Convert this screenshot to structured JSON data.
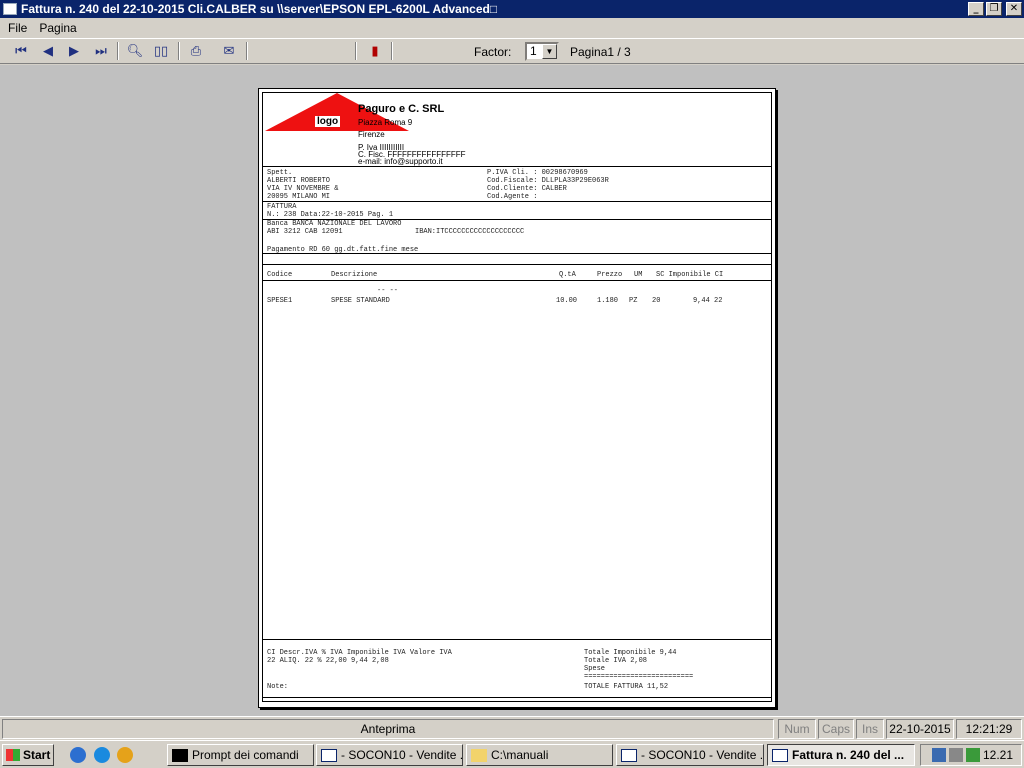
{
  "window": {
    "title": "Fattura n.  240 del 22-10-2015 Cli.CALBER su \\\\server\\EPSON EPL-6200L Advanced□"
  },
  "menu": {
    "file": "File",
    "pagina": "Pagina"
  },
  "toolbar": {
    "factor_label": "Factor:",
    "factor_value": "1",
    "page_indicator": "Pagina1 / 3"
  },
  "invoice": {
    "logo_text": "logo",
    "company": {
      "name": "Paguro e C. SRL",
      "address": "Piazza Roma 9",
      "city": "Firenze",
      "piva": "P. Iva  IIIIIIIIIII",
      "cf": "C. Fisc. FFFFFFFFFFFFFFFF",
      "email": "e-mail: info@supporto.it"
    },
    "customer": {
      "spett": "Spett.",
      "name": "ALBERTI ROBERTO",
      "street": "VIA IV NOVEMBRE &",
      "city": "20095 MILANO MI"
    },
    "customer_codes": {
      "piva": "P.IVA Cli. : 00298670969",
      "cf": "Cod.Fiscale: DLLPLA33P29E063R",
      "cliente": "Cod.Cliente: CALBER",
      "agente": "Cod.Agente :"
    },
    "doc": {
      "type": "FATTURA",
      "number_line": "N.:  238 Data:22-10-2015   Pag.  1"
    },
    "bank": {
      "name": "Banca  BANCA NAZIONALE DEL LAVORO",
      "abi_cab": "  ABI  3212   CAB  12091",
      "iban": "IBAN:ITCCCCCCCCCCCCCCCCCCC"
    },
    "payment": "Pagamento  RD 60 gg.dt.fatt.fine mese",
    "columns": {
      "codice": "Codice",
      "descrizione": "Descrizione",
      "qta": "Q.tA",
      "prezzo": "Prezzo",
      "um": "UM",
      "sc_imponibile": "SC Imponibile CI"
    },
    "marker": "-- --",
    "row": {
      "codice": "SPESE1",
      "descrizione": "SPESE STANDARD",
      "qta": "10.00",
      "prezzo": "1.180",
      "um": "PZ",
      "sc": "20",
      "imponibile_ci": "9,44 22"
    },
    "iva_header": "CI  Descr.IVA      % IVA  Imponibile IVA   Valore IVA",
    "iva_row": "22  ALIQ. 22 %     22,00          9,44        2,08",
    "totals": {
      "imponibile": "Totale Imponibile          9,44",
      "iva": "Totale IVA                 2,08",
      "spese": "Spese",
      "separator": "==========================",
      "fattura": "TOTALE FATTURA            11,52"
    },
    "note_label": "Note:"
  },
  "statusbar": {
    "mode": "Anteprima",
    "num": "Num",
    "caps": "Caps",
    "ins": "Ins",
    "date": "22-10-2015",
    "time": "12:21:29"
  },
  "taskbar": {
    "start": "Start",
    "tasks": [
      "Prompt dei comandi",
      "- SOCON10 - Vendite ...",
      "C:\\manuali",
      "- SOCON10 - Vendite ...",
      "Fattura n.  240 del ..."
    ],
    "clock": "12.21"
  },
  "colors": {
    "titlebar": "#0a246a",
    "logo": "#ee1111",
    "desktop_bg": "#c0c0c0",
    "chrome": "#d4d0c8"
  }
}
